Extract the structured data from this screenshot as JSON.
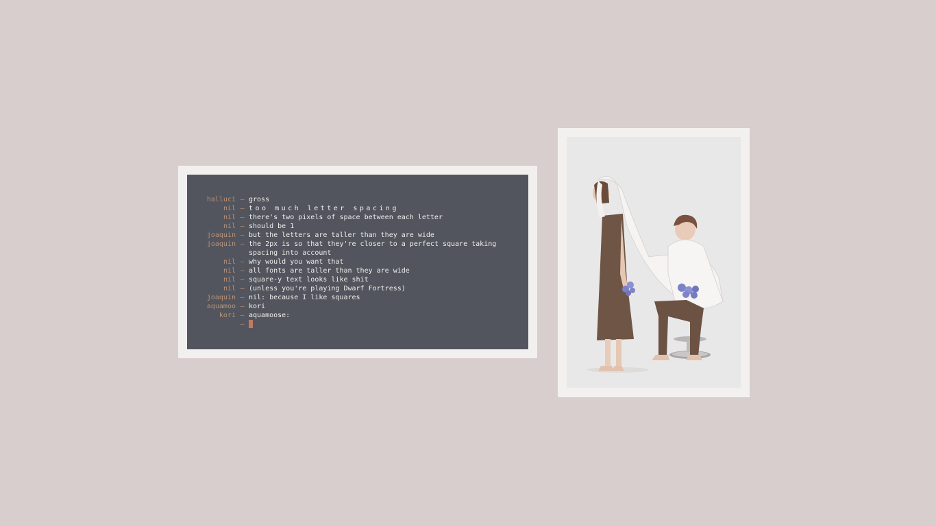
{
  "terminal": {
    "lines": [
      {
        "nick": "halluci",
        "msg": "gross"
      },
      {
        "nick": "nil",
        "msg": "too much letter spacing",
        "spaced": true
      },
      {
        "nick": "nil",
        "msg": "there's two pixels of space between each letter"
      },
      {
        "nick": "nil",
        "msg": "should be 1"
      },
      {
        "nick": "joaquin",
        "msg": "but the letters are taller than they are wide"
      },
      {
        "nick": "joaquin",
        "msg": "the 2px is so that they're closer to a perfect square taking spacing into account"
      },
      {
        "nick": "nil",
        "msg": "why would you want that"
      },
      {
        "nick": "nil",
        "msg": "all fonts are taller than they are wide"
      },
      {
        "nick": "nil",
        "msg": "square-y text looks like shit"
      },
      {
        "nick": "nil",
        "msg": "(unless you're playing Dwarf Fortress)"
      },
      {
        "nick": "joaquin",
        "msg": "nil: because I like squares"
      },
      {
        "nick": "aquamoo",
        "msg": "kori"
      },
      {
        "nick": "kori",
        "msg": "aquamoose:"
      }
    ],
    "separator": "–"
  },
  "colors": {
    "desktop_bg": "#d8cecd",
    "terminal_bg": "#52555d",
    "nick": "#b8937a",
    "cursor": "#c07a62"
  },
  "picture": {
    "icon": "illustration-two-figures-with-white-cloth-and-blue-flowers"
  }
}
